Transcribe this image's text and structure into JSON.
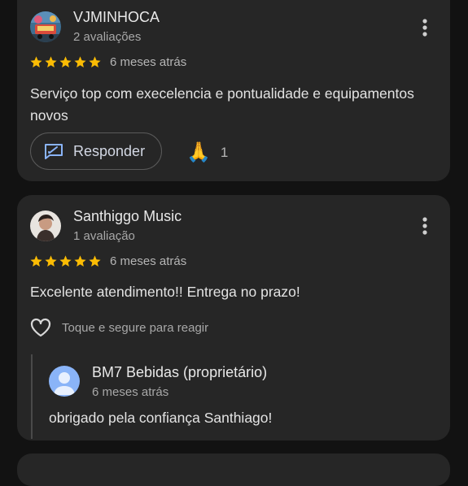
{
  "reviews": [
    {
      "author": "VJMINHOCA",
      "meta": "2 avaliações",
      "rating": 5,
      "date": "6 meses atrás",
      "text": "Serviço top com execelencia e pontualidade e equipamentos novos",
      "reply_label": "Responder",
      "reaction_emoji": "🙏",
      "reaction_count": "1"
    },
    {
      "author": "Santhiggo Music",
      "meta": "1 avaliação",
      "rating": 5,
      "date": "6 meses atrás",
      "text": "Excelente atendimento!! Entrega no prazo!",
      "react_hint": "Toque e segure para reagir",
      "owner_reply": {
        "author": "BM7 Bebidas (proprietário)",
        "date": "6 meses atrás",
        "text": "obrigado pela confiança Santhiago!"
      }
    }
  ],
  "colors": {
    "background": "#121212",
    "card": "#262626",
    "star": "#fbbc04",
    "owner_avatar": "#8ab4f8"
  },
  "icons": [
    "more-vert-icon",
    "star-icon",
    "reply-icon",
    "heart-outline-icon",
    "person-icon"
  ]
}
